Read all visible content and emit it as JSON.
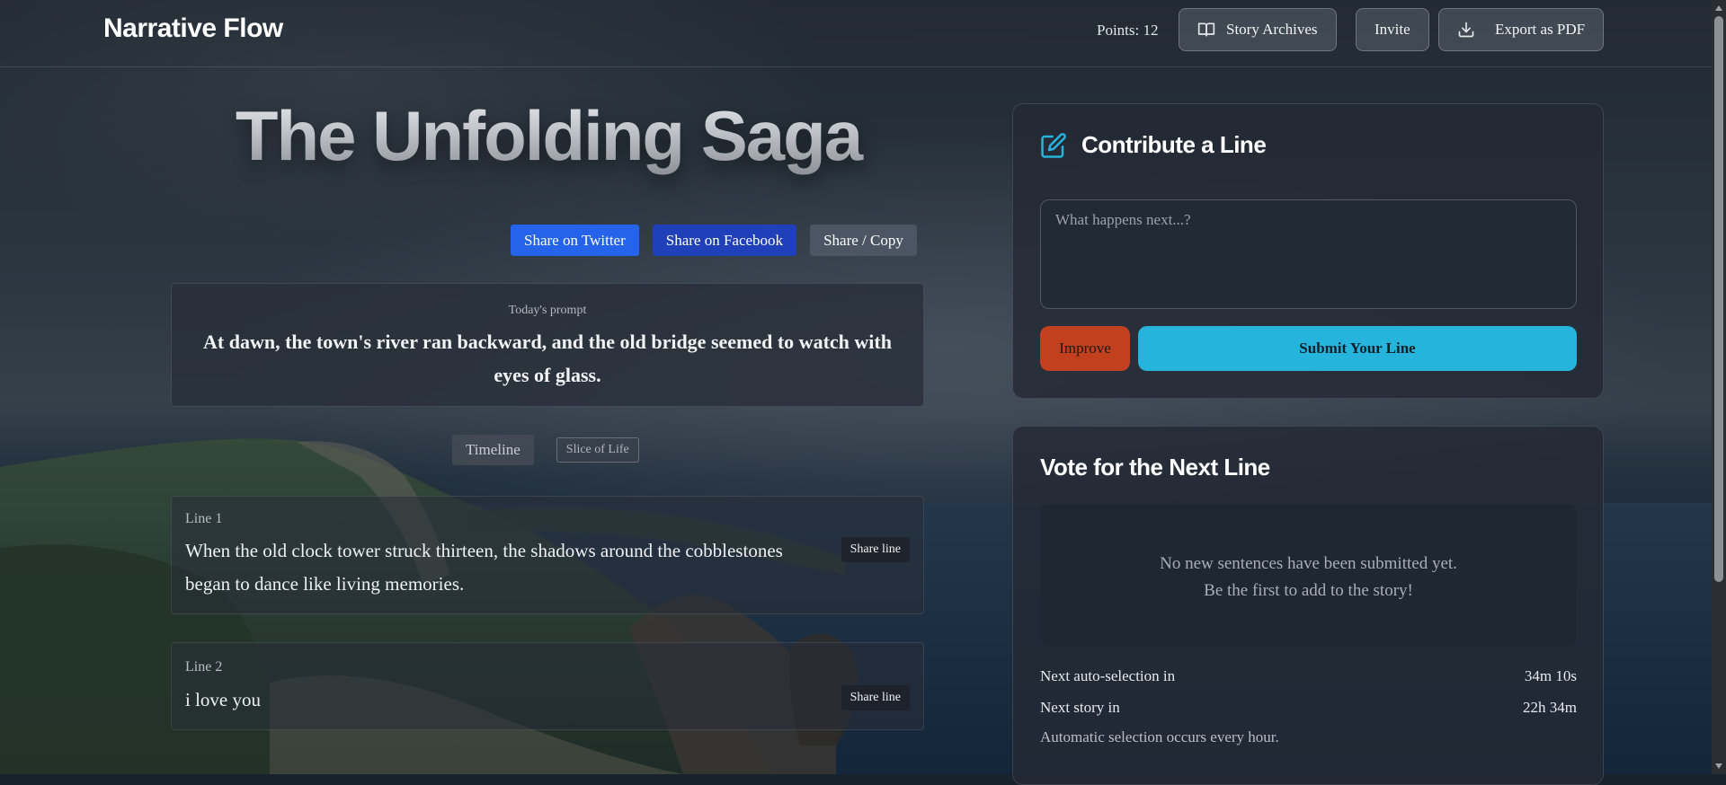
{
  "app": {
    "brand": "Narrative Flow"
  },
  "header": {
    "points": "Points: 12",
    "archives_label": "Story Archives",
    "invite_label": "Invite",
    "export_label": "Export as PDF"
  },
  "story": {
    "title": "The Unfolding Saga"
  },
  "share": {
    "twitter": "Share on Twitter",
    "facebook": "Share on Facebook",
    "copy": "Share / Copy"
  },
  "prompt": {
    "label": "Today's prompt",
    "text": "At dawn, the town's river ran backward, and the old bridge seemed to watch with eyes of glass."
  },
  "tabs": {
    "timeline": "Timeline",
    "genre": "Slice of Life"
  },
  "lines": [
    {
      "number": "Line 1",
      "text": "When the old clock tower struck thirteen, the shadows around the cobblestones began to dance like living memories.",
      "share_label": "Share line"
    },
    {
      "number": "Line 2",
      "text": "i love you",
      "share_label": "Share line"
    }
  ],
  "contribute": {
    "heading": "Contribute a Line",
    "placeholder": "What happens next...?",
    "improve_label": "Improve",
    "submit_label": "Submit Your Line"
  },
  "vote": {
    "heading": "Vote for the Next Line",
    "empty_line1": "No new sentences have been submitted yet.",
    "empty_line2": "Be the first to add to the story!",
    "auto_label": "Next auto-selection in",
    "auto_value": "34m 10s",
    "next_story_label": "Next story in",
    "next_story_value": "22h 34m",
    "note": "Automatic selection occurs every hour."
  },
  "colors": {
    "accent": "#26b4dc",
    "improve": "#c2401e",
    "twitter": "#2563eb",
    "facebook": "#1f40b8"
  }
}
